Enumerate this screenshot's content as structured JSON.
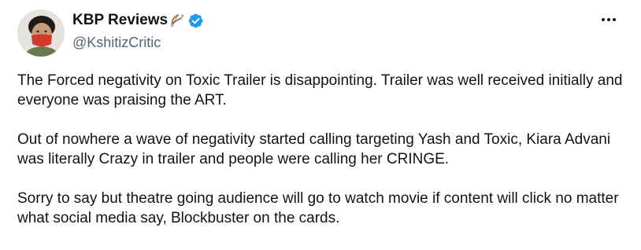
{
  "author": {
    "display_name": "KBP Reviews",
    "handle": "@KshitizCritic",
    "emoji_icon": "bow-and-arrow-icon",
    "verified_icon": "verified-badge-icon",
    "verified_color": "#1d9bf0"
  },
  "menu_icon": "more-horizontal-icon",
  "tweet": {
    "paragraphs": [
      "The Forced negativity on Toxic Trailer is disappointing. Trailer was well received initially and everyone was praising the ART.",
      "Out of nowhere a wave of negativity started calling targeting Yash and Toxic, Kiara Advani was literally Crazy in trailer and people were calling her CRINGE.",
      "Sorry to say but theatre going audience will go to watch movie if content will click no matter what social media say, Blockbuster on the cards."
    ]
  },
  "colors": {
    "text_primary": "#0f1419",
    "text_secondary": "#536471"
  }
}
